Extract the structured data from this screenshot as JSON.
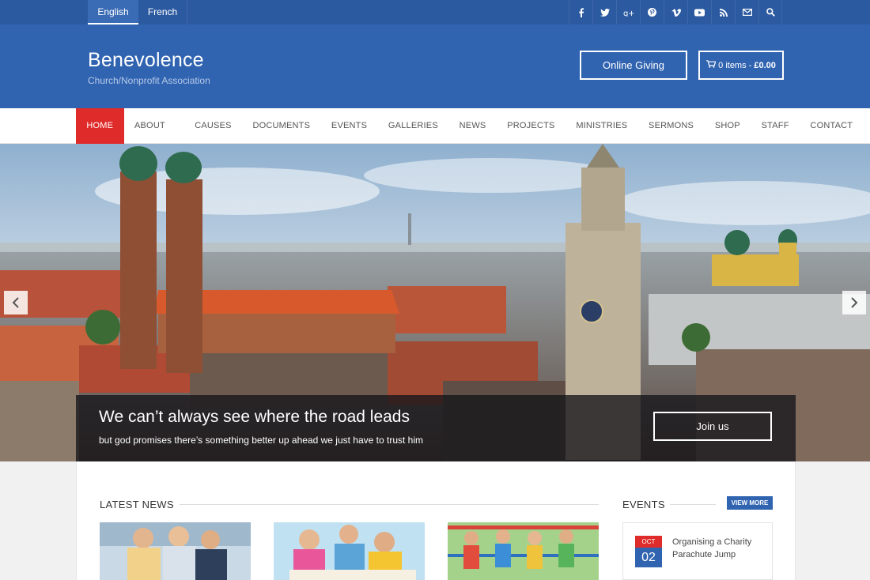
{
  "topbar": {
    "languages": [
      "English",
      "French"
    ],
    "social_icons": [
      "facebook-icon",
      "twitter-icon",
      "google-plus-icon",
      "pinterest-icon",
      "vimeo-icon",
      "youtube-icon",
      "rss-icon",
      "email-icon",
      "search-icon"
    ]
  },
  "header": {
    "title": "Benevolence",
    "subtitle": "Church/Nonprofit Association",
    "giving_label": "Online Giving",
    "cart_items": "0 items -",
    "cart_total": "£0.00"
  },
  "nav": {
    "items": [
      "HOME",
      "ABOUT US",
      "CAUSES",
      "DOCUMENTS",
      "EVENTS",
      "GALLERIES",
      "NEWS",
      "PROJECTS",
      "MINISTRIES",
      "SERMONS",
      "SHOP",
      "STAFF",
      "CONTACT US"
    ],
    "active": "HOME"
  },
  "hero": {
    "title": "We can’t always see where the road leads",
    "subtitle": "but god promises there’s something better up ahead we just have to trust him",
    "button": "Join us"
  },
  "news": {
    "title": "LATEST NEWS"
  },
  "events": {
    "title": "EVENTS",
    "view_more": "VIEW MORE",
    "items": [
      {
        "month": "OCT",
        "day": "02",
        "title": "Organising a Charity Parachute Jump"
      }
    ]
  },
  "colors": {
    "topbar": "#2c5aa0",
    "header": "#3063b0",
    "accent_red": "#e02b2b"
  }
}
